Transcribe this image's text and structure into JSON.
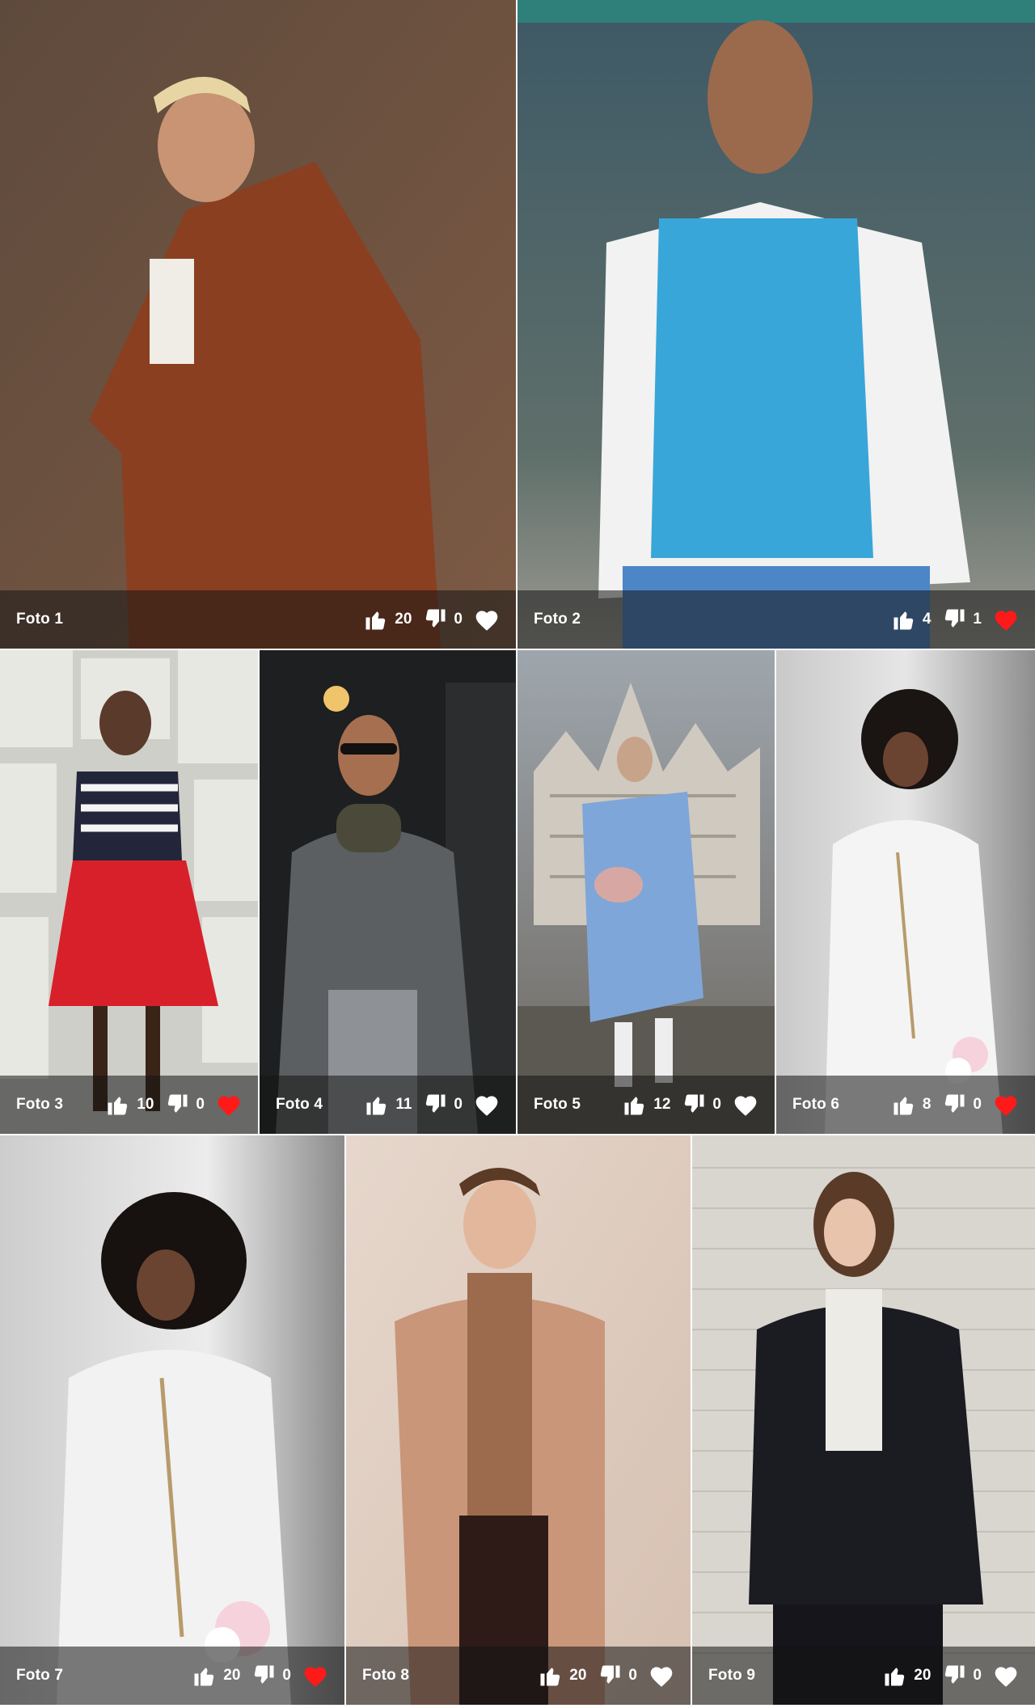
{
  "colors": {
    "like_active": "#ff1a1a",
    "like_inactive": "#ffffff"
  },
  "photos": [
    {
      "label": "Foto 1",
      "likes": "20",
      "dislikes": "0",
      "favorite": false,
      "bg": [
        "#5e4a3c",
        "#7d5a44"
      ],
      "subject": "#8a3f21"
    },
    {
      "label": "Foto 2",
      "likes": "4",
      "dislikes": "1",
      "favorite": true,
      "bg": [
        "#3d5966",
        "#5f6f6a"
      ],
      "subject": "#39a6d9"
    },
    {
      "label": "Foto 3",
      "likes": "10",
      "dislikes": "0",
      "favorite": true,
      "bg": [
        "#d8d8d2",
        "#a9aaa4"
      ],
      "subject": "#d8202a"
    },
    {
      "label": "Foto 4",
      "likes": "11",
      "dislikes": "0",
      "favorite": false,
      "bg": [
        "#1d1f21",
        "#3a3b3c"
      ],
      "subject": "#5b5f61"
    },
    {
      "label": "Foto 5",
      "likes": "12",
      "dislikes": "0",
      "favorite": false,
      "bg": [
        "#9ea6ad",
        "#6d6760"
      ],
      "subject": "#7fa6d8"
    },
    {
      "label": "Foto 6",
      "likes": "8",
      "dislikes": "0",
      "favorite": true,
      "bg": [
        "#c9c9c9",
        "#8e8e8e"
      ],
      "subject": "#f4f4f4"
    },
    {
      "label": "Foto 7",
      "likes": "20",
      "dislikes": "0",
      "favorite": true,
      "bg": [
        "#cdcdcd",
        "#8b8b8b"
      ],
      "subject": "#f2f2f2"
    },
    {
      "label": "Foto 8",
      "likes": "20",
      "dislikes": "0",
      "favorite": false,
      "bg": [
        "#e6d7cc",
        "#d6c0b1"
      ],
      "subject": "#c9967a"
    },
    {
      "label": "Foto 9",
      "likes": "20",
      "dislikes": "0",
      "favorite": false,
      "bg": [
        "#d8d6cf",
        "#bdbab2"
      ],
      "subject": "#1b1b22"
    }
  ]
}
